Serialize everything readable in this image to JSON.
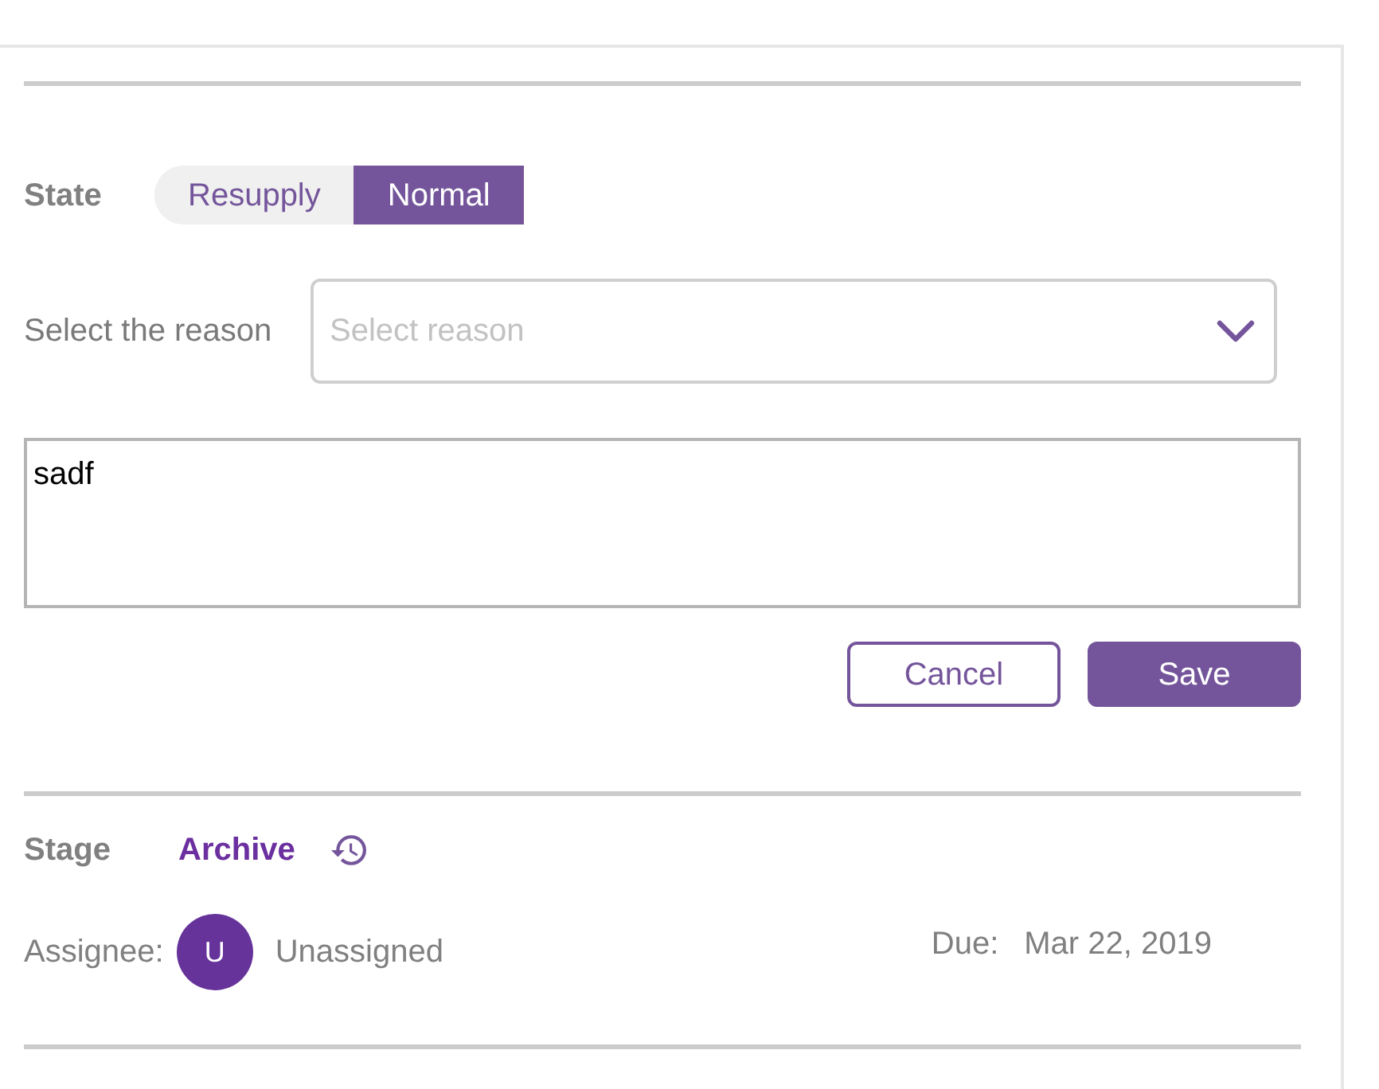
{
  "state": {
    "label": "State",
    "options": [
      {
        "label": "Resupply",
        "selected": false
      },
      {
        "label": "Normal",
        "selected": true
      }
    ]
  },
  "reason": {
    "label": "Select the reason",
    "placeholder": "Select reason"
  },
  "comment": {
    "value": "sadf"
  },
  "buttons": [
    {
      "label": "Cancel",
      "kind": "secondary"
    },
    {
      "label": "Save",
      "kind": "primary"
    }
  ],
  "stage": {
    "label": "Stage",
    "value": "Archive"
  },
  "assignee": {
    "label": "Assignee:",
    "initial": "U",
    "name": "Unassigned"
  },
  "due": {
    "label": "Due:",
    "value": "Mar 22, 2019"
  }
}
